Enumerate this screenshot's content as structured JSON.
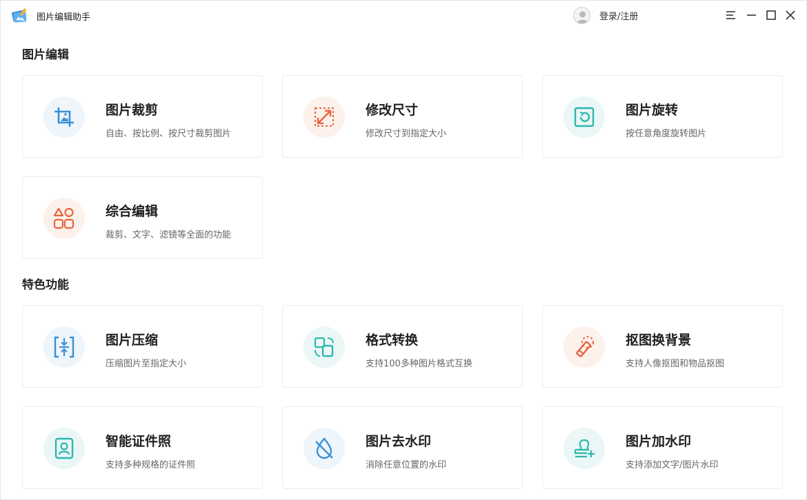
{
  "window": {
    "title": "图片编辑助手",
    "login_label": "登录/注册"
  },
  "sections": [
    {
      "title": "图片编辑",
      "cards": [
        {
          "title": "图片裁剪",
          "desc": "自由、按比例、按尺寸裁剪图片",
          "icon": "crop-icon"
        },
        {
          "title": "修改尺寸",
          "desc": "修改尺寸到指定大小",
          "icon": "resize-icon"
        },
        {
          "title": "图片旋转",
          "desc": "按任意角度旋转图片",
          "icon": "rotate-icon"
        },
        {
          "title": "综合编辑",
          "desc": "裁剪、文字、滤镜等全面的功能",
          "icon": "shapes-icon"
        }
      ]
    },
    {
      "title": "特色功能",
      "cards": [
        {
          "title": "图片压缩",
          "desc": "压缩图片至指定大小",
          "icon": "compress-icon"
        },
        {
          "title": "格式转换",
          "desc": "支持100多种图片格式互换",
          "icon": "convert-icon"
        },
        {
          "title": "抠图换背景",
          "desc": "支持人像抠图和物品抠图",
          "icon": "eraser-icon"
        },
        {
          "title": "智能证件照",
          "desc": "支持多种规格的证件照",
          "icon": "id-photo-icon"
        },
        {
          "title": "图片去水印",
          "desc": "消除任意位置的水印",
          "icon": "remove-watermark-icon"
        },
        {
          "title": "图片加水印",
          "desc": "支持添加文字/图片水印",
          "icon": "add-watermark-icon"
        }
      ]
    }
  ],
  "colors": {
    "blue": "#3a8fd6",
    "orange": "#e8643c",
    "teal": "#2cb7ae"
  }
}
